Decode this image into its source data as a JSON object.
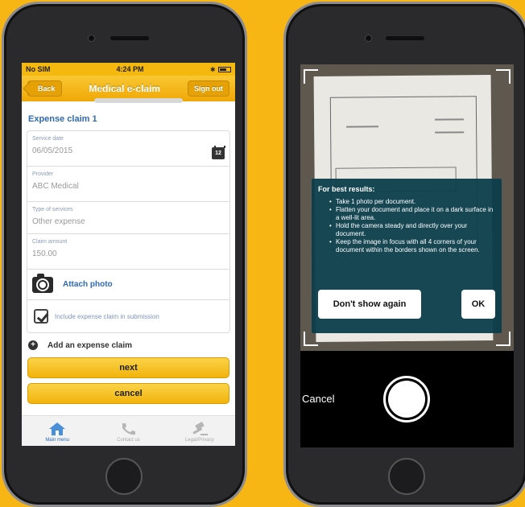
{
  "left_screen": {
    "status": {
      "carrier": "No SIM",
      "time": "4:24 PM",
      "bt": "∗"
    },
    "navbar": {
      "back": "Back",
      "title": "Medical e-claim",
      "signout": "Sign out"
    },
    "section_title": "Expense claim 1",
    "fields": {
      "service_date": {
        "label": "Service date",
        "value": "06/05/2015"
      },
      "provider": {
        "label": "Provider",
        "value": "ABC Medical"
      },
      "type": {
        "label": "Type of services",
        "value": "Other expense"
      },
      "amount": {
        "label": "Claim amount",
        "value": "150.00"
      }
    },
    "calendar_day": "12",
    "attach_label": "Attach photo",
    "include_label": "Include expense claim in submission",
    "add_label": "Add an expense claim",
    "next_label": "next",
    "cancel_label": "cancel",
    "tabs": {
      "main": "Main menu",
      "contact": "Contact us",
      "legal": "Legal/Privacy"
    }
  },
  "right_screen": {
    "tips_title": "For best results:",
    "tips": [
      "Take 1 photo per document.",
      "Flatten your document and place it on a dark surface in a well-lit area.",
      "Hold the camera steady and directly over your document.",
      "Keep the image in focus with all 4 corners of your document within the borders shown on the screen."
    ],
    "dont_show_label": "Don't show again",
    "ok_label": "OK",
    "cancel_label": "Cancel"
  },
  "colors": {
    "background": "#f8b615",
    "accent_blue": "#2e6ab3",
    "overlay": "#0c3e4b"
  }
}
